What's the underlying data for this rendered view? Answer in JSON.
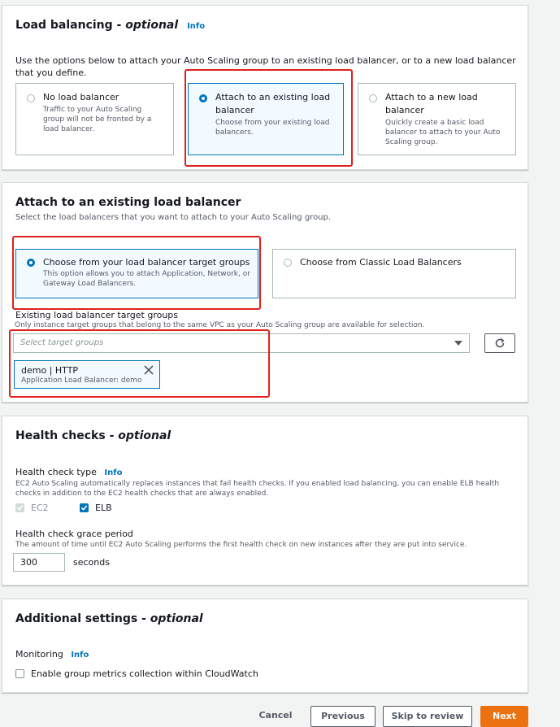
{
  "load_balancing": {
    "title": "Load balancing - ",
    "title_optional": "optional",
    "info": "Info",
    "description": "Use the options below to attach your Auto Scaling group to an existing load balancer, or to a new load balancer that you define.",
    "options": [
      {
        "title": "No load balancer",
        "desc": "Traffic to your Auto Scaling group will not be fronted by a load balancer.",
        "selected": false
      },
      {
        "title": "Attach to an existing load balancer",
        "desc": "Choose from your existing load balancers.",
        "selected": true
      },
      {
        "title": "Attach to a new load balancer",
        "desc": "Quickly create a basic load balancer to attach to your Auto Scaling group.",
        "selected": false
      }
    ]
  },
  "attach_existing": {
    "title": "Attach to an existing load balancer",
    "description": "Select the load balancers that you want to attach to your Auto Scaling group.",
    "options": [
      {
        "title": "Choose from your load balancer target groups",
        "desc": "This option allows you to attach Application, Network, or Gateway Load Balancers.",
        "selected": true
      },
      {
        "title": "Choose from Classic Load Balancers",
        "desc": "",
        "selected": false
      }
    ],
    "target_groups_label": "Existing load balancer target groups",
    "target_groups_desc": "Only instance target groups that belong to the same VPC as your Auto Scaling group are available for selection.",
    "select_placeholder": "Select target groups",
    "selected_token": {
      "title": "demo | HTTP",
      "subtitle": "Application Load Balancer: demo"
    }
  },
  "health_checks": {
    "title": "Health checks - ",
    "title_optional": "optional",
    "type_label": "Health check type",
    "info": "Info",
    "type_desc": "EC2 Auto Scaling automatically replaces instances that fail health checks. If you enabled load balancing, you can enable ELB health checks in addition to the EC2 health checks that are always enabled.",
    "ec2_label": "EC2",
    "elb_label": "ELB",
    "grace_label": "Health check grace period",
    "grace_desc": "The amount of time until EC2 Auto Scaling performs the first health check on new instances after they are put into service.",
    "grace_value": "300",
    "grace_unit": "seconds"
  },
  "additional_settings": {
    "title": "Additional settings - ",
    "title_optional": "optional",
    "monitoring_label": "Monitoring",
    "info": "Info",
    "metrics_label": "Enable group metrics collection within CloudWatch"
  },
  "footer": {
    "cancel": "Cancel",
    "previous": "Previous",
    "skip": "Skip to review",
    "next": "Next"
  },
  "colors": {
    "accent": "#0073bb",
    "highlight_box": "#e0201b",
    "primary_button": "#ec7211"
  }
}
